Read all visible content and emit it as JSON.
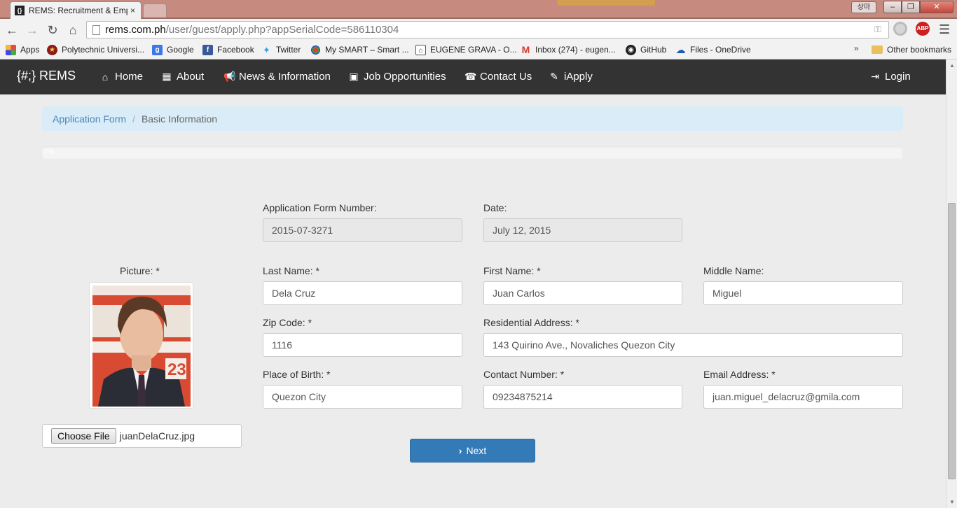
{
  "browser": {
    "tab_title": "REMS: Recruitment & Emp",
    "tab_close": "×",
    "window_user": "상마",
    "window_buttons": {
      "min": "–",
      "max": "❐",
      "close": "✕"
    },
    "url_host": "rems.com.ph",
    "url_path": "/user/guest/apply.php?appSerialCode=586110304",
    "ext_abp": "ABP",
    "bookmarks": [
      {
        "label": "Apps",
        "icon": "apps-grid-icon"
      },
      {
        "label": "Polytechnic Universi...",
        "icon": "pup-seal-icon"
      },
      {
        "label": "Google",
        "icon": "google-icon"
      },
      {
        "label": "Facebook",
        "icon": "facebook-icon"
      },
      {
        "label": "Twitter",
        "icon": "twitter-icon"
      },
      {
        "label": "My SMART – Smart ...",
        "icon": "smart-icon"
      },
      {
        "label": "EUGENE GRAVA - O...",
        "icon": "avatar-icon"
      },
      {
        "label": "Inbox (274) - eugen...",
        "icon": "gmail-icon"
      },
      {
        "label": "GitHub",
        "icon": "github-icon"
      },
      {
        "label": "Files - OneDrive",
        "icon": "onedrive-icon"
      }
    ],
    "bookmarks_more": "»",
    "other_bookmarks": "Other bookmarks"
  },
  "navbar": {
    "brand": "{#;} REMS",
    "links": [
      {
        "label": "Home",
        "icon": "home-icon"
      },
      {
        "label": "About",
        "icon": "grid-icon"
      },
      {
        "label": "News & Information",
        "icon": "megaphone-icon"
      },
      {
        "label": "Job Opportunities",
        "icon": "briefcase-icon"
      },
      {
        "label": "Contact Us",
        "icon": "phone-icon"
      },
      {
        "label": "iApply",
        "icon": "pencil-icon"
      }
    ],
    "login": "Login"
  },
  "breadcrumb": {
    "link": "Application Form",
    "separator": "/",
    "active": "Basic Information"
  },
  "progress": {
    "percent": 0,
    "label": "0%"
  },
  "form": {
    "picture_label": "Picture: *",
    "file_button": "Choose File",
    "file_name": "juanDelaCruz.jpg",
    "app_number_label": "Application Form Number:",
    "app_number": "2015-07-3271",
    "date_label": "Date:",
    "date": "July 12, 2015",
    "last_name_label": "Last Name: *",
    "last_name": "Dela Cruz",
    "first_name_label": "First Name: *",
    "first_name": "Juan Carlos",
    "middle_name_label": "Middle Name:",
    "middle_name": "Miguel",
    "zip_label": "Zip Code: *",
    "zip": "1116",
    "address_label": "Residential Address: *",
    "address": "143 Quirino Ave., Novaliches Quezon City",
    "birthplace_label": "Place of Birth: *",
    "birthplace": "Quezon City",
    "contact_label": "Contact Number: *",
    "contact": "09234875214",
    "email_label": "Email Address: *",
    "email": "juan.miguel_delacruz@gmila.com",
    "next_button": "Next"
  },
  "colors": {
    "navbar": "#333333",
    "breadcrumb": "#d9ecf7",
    "primary": "#337ab7",
    "background": "#ececec"
  }
}
